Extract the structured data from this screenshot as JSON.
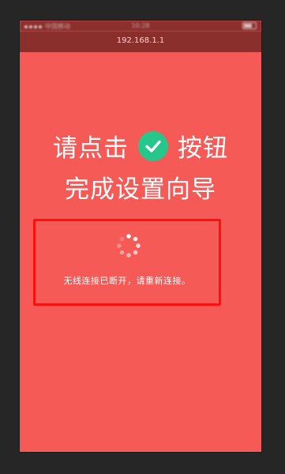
{
  "status_bar": {
    "carrier": "中国移动",
    "time": "10:28"
  },
  "url_bar": {
    "address": "192.168.1.1"
  },
  "heading": {
    "line1_before": "请点击",
    "line1_after": "按钮",
    "line2": "完成设置向导"
  },
  "notice": {
    "message": "无线连接已断开，请重新连接。"
  },
  "colors": {
    "background": "#f65a57",
    "bar": "#8b2f2d",
    "check": "#26c78a",
    "highlight_border": "#ff1010"
  },
  "icons": {
    "check": "check-circle-icon",
    "loading": "loading-spinner-icon"
  }
}
